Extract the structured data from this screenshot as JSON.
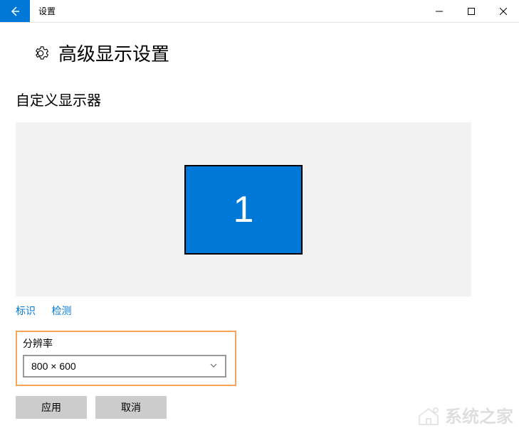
{
  "titlebar": {
    "title": "设置"
  },
  "page": {
    "title": "高级显示设置",
    "section_title": "自定义显示器"
  },
  "monitor": {
    "number": "1"
  },
  "links": {
    "identify": "标识",
    "detect": "检测"
  },
  "resolution": {
    "label": "分辨率",
    "value": "800 × 600"
  },
  "buttons": {
    "apply": "应用",
    "cancel": "取消"
  },
  "watermark": {
    "text": "系统之家"
  }
}
